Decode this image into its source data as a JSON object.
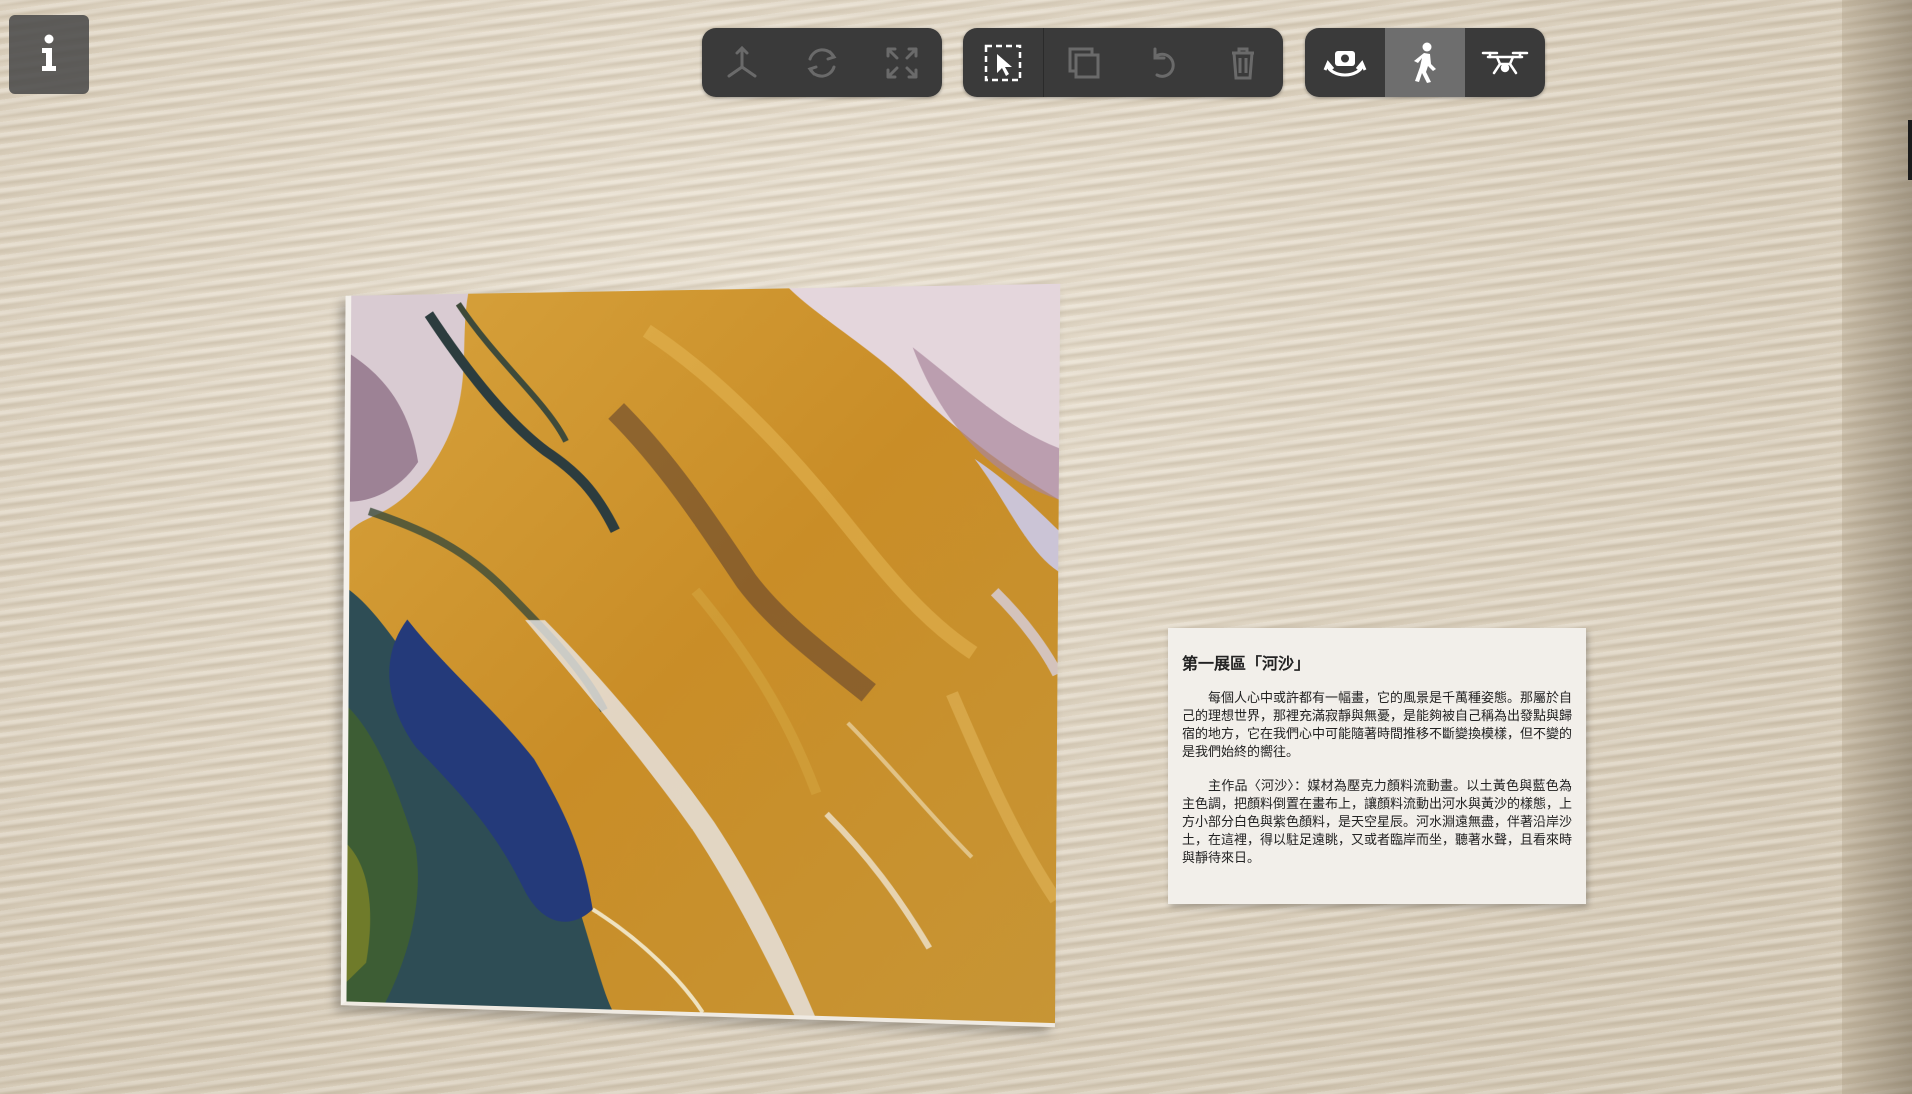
{
  "toolbar": {
    "transform_group": [
      {
        "icon": "axis-move-icon"
      },
      {
        "icon": "rotate-icon"
      },
      {
        "icon": "scale-icon"
      }
    ],
    "edit_group": [
      {
        "icon": "select-icon"
      },
      {
        "icon": "duplicate-icon"
      },
      {
        "icon": "undo-icon"
      },
      {
        "icon": "delete-icon"
      }
    ],
    "view_group": [
      {
        "icon": "orbit-camera-icon"
      },
      {
        "icon": "walk-icon",
        "active": true
      },
      {
        "icon": "drone-icon"
      }
    ]
  },
  "info_button": {
    "icon": "info-icon"
  },
  "placard": {
    "title": "第一展區「河沙」",
    "paragraph1": "每個人心中或許都有一幅畫，它的風景是千萬種姿態。那屬於自己的理想世界，那裡充滿寂靜與無憂，是能夠被自己稱為出發點與歸宿的地方，它在我們心中可能隨著時間推移不斷變換模樣，但不變的是我們始終的嚮往。",
    "paragraph2": "主作品〈河沙〉：媒材為壓克力顏料流動畫。以土黃色與藍色為主色調，把顏料倒置在畫布上，讓顏料流動出河水與黃沙的樣態，上方小部分白色與紫色顏料，是天空星辰。河水淵遠無盡，伴著沿岸沙土，在這裡，得以駐足遠眺，又或者臨岸而坐，聽著水聲，且看來時與靜待來日。"
  },
  "colors": {
    "toolbar_bg": "#3a3a3a",
    "active_tool_bg": "#6e6e6e",
    "icon_enabled": "#ffffff",
    "icon_disabled": "#6a6a6a"
  }
}
